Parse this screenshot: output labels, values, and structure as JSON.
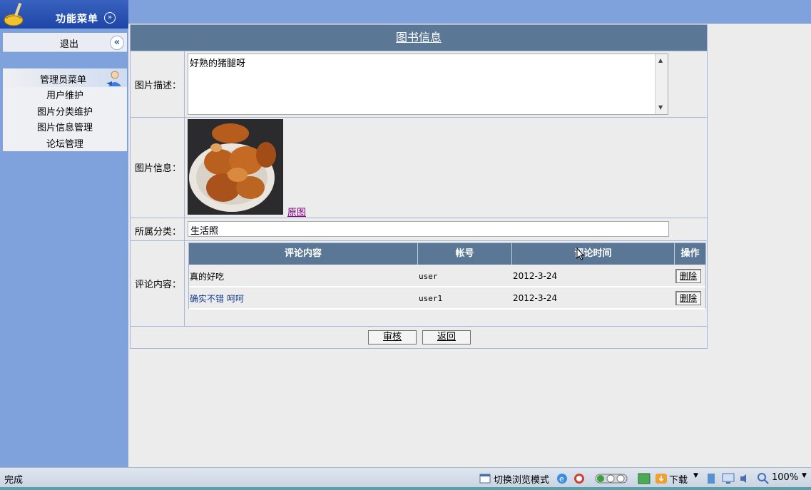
{
  "sidebar": {
    "title": "功能菜单",
    "title_toggle": "»",
    "logout_label": "退出",
    "logout_button": "«",
    "menu_head": "管理员菜单",
    "items": [
      {
        "label": "用户维护"
      },
      {
        "label": "图片分类维护"
      },
      {
        "label": "图片信息管理"
      },
      {
        "label": "论坛管理"
      }
    ]
  },
  "form": {
    "title": "图书信息",
    "desc_label": "图片描述：",
    "desc_value": "好熟的猪腿呀",
    "photo_label": "图片信息：",
    "photo_link": "原图",
    "category_label": "所属分类：",
    "category_value": "生活照",
    "comment_label": "评论内容："
  },
  "comments": {
    "headers": [
      "评论内容",
      "帐号",
      "评论时间",
      "操作"
    ],
    "rows": [
      {
        "content": "真的好吃",
        "account": "user",
        "time": "2012-3-24",
        "action": "删除"
      },
      {
        "content": "确实不错 呵呵",
        "account": "user1",
        "time": "2012-3-24",
        "action": "删除"
      }
    ]
  },
  "buttons": {
    "approve": "审核",
    "back": "返回"
  },
  "statusbar": {
    "status": "完成",
    "switch_mode": "切换浏览模式",
    "download": "下载",
    "zoom": "100%"
  },
  "colors": {
    "sidebar_bg": "#7fa1dc",
    "header_bg": "#5a7896",
    "visited_link": "#800080",
    "comment_link": "#1a3a8c"
  }
}
